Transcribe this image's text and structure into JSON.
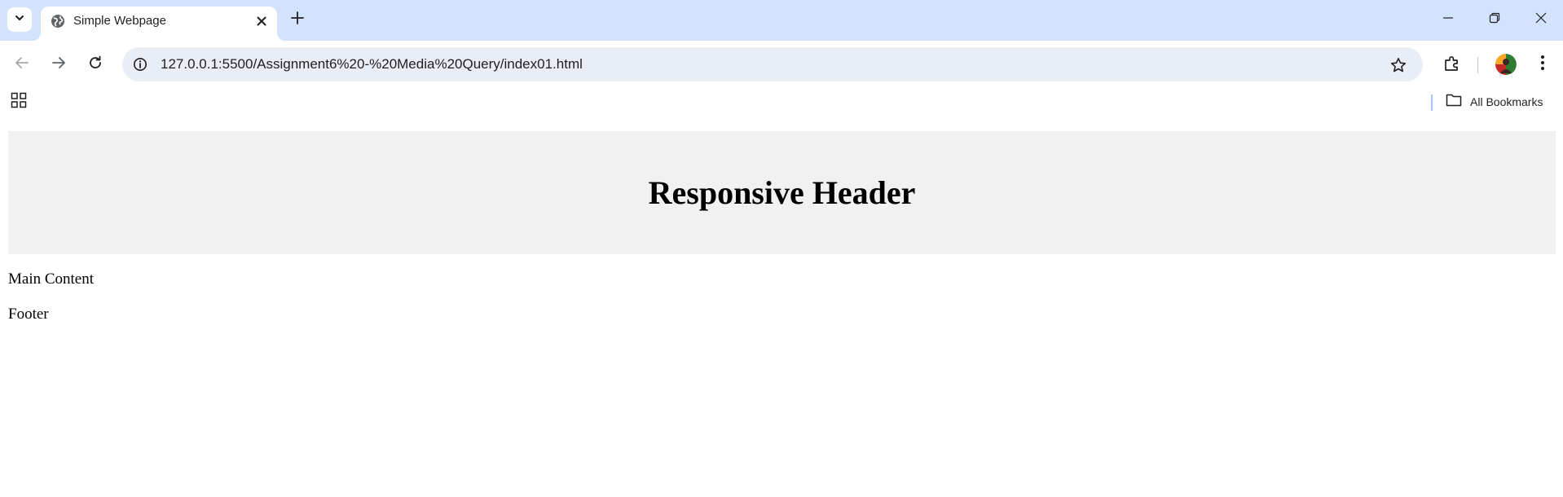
{
  "browser": {
    "tab": {
      "title": "Simple Webpage",
      "favicon": "globe-icon"
    },
    "address_bar": {
      "url": "127.0.0.1:5500/Assignment6%20-%20Media%20Query/index01.html"
    },
    "bookmarks_bar": {
      "all_bookmarks_label": "All Bookmarks"
    },
    "icons": [
      "chevron-down-icon",
      "close-icon",
      "plus-icon",
      "minimize-icon",
      "restore-icon",
      "window-close-icon",
      "back-arrow-icon",
      "forward-arrow-icon",
      "reload-icon",
      "info-icon",
      "star-icon",
      "extensions-icon",
      "avatar",
      "more-vert-icon",
      "apps-grid-icon",
      "folder-icon"
    ],
    "colors": {
      "tabstrip_bg": "#d3e3fd",
      "omnibox_bg": "#e9eef6",
      "header_bg": "#f1f1f1"
    }
  },
  "page": {
    "header_title": "Responsive Header",
    "main_text": "Main Content",
    "footer_text": "Footer"
  }
}
